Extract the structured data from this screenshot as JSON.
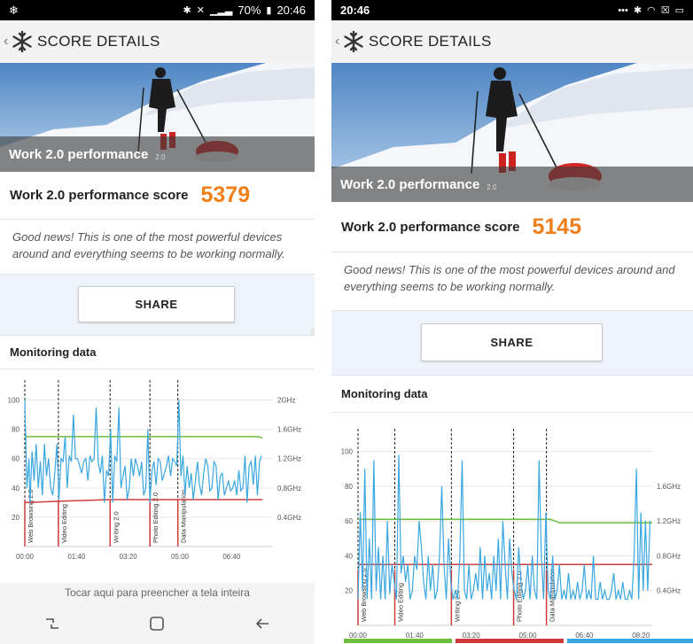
{
  "app": {
    "title": "SCORE DETAILS",
    "benchmark_name": "Work 2.0 performance",
    "benchmark_version": "2.0"
  },
  "colors": {
    "score": "#f07f1a",
    "series": "#3aa7e0",
    "frequency_line": "#6cbf3c",
    "temperature_line": "#cf3b3b"
  },
  "left": {
    "status": {
      "time": "20:46",
      "battery": "70%"
    },
    "score_label": "Work 2.0 performance score",
    "score_value": "5379",
    "message": "Good news! This is one of the most powerful devices around and everything seems to be working normally.",
    "share_label": "SHARE",
    "monitor_title": "Monitoring data",
    "caption": "Tocar aqui para preencher a tela inteira",
    "icons": [
      "back-chevron-icon",
      "snowflake-logo-icon",
      "recent-apps-icon",
      "home-icon",
      "back-arrow-icon"
    ]
  },
  "right": {
    "status": {
      "time": "20:46"
    },
    "score_label": "Work 2.0 performance score",
    "score_value": "5145",
    "message": "Good news! This is one of the most powerful devices around and everything seems to be working normally.",
    "share_label": "SHARE",
    "monitor_title": "Monitoring data",
    "icons": [
      "back-chevron-icon",
      "snowflake-logo-icon",
      "wifi-icon",
      "battery-icon"
    ]
  },
  "chart_data": [
    {
      "type": "line",
      "title": "Monitoring data",
      "x_ticks": [
        "00:00",
        "01:40",
        "03:20",
        "05:00",
        "06:40"
      ],
      "x_range_seconds": [
        0,
        480
      ],
      "y_left_ticks": [
        20,
        40,
        60,
        80,
        100
      ],
      "y_left_range": [
        0,
        110
      ],
      "y_right_ticks": [
        "0.4GHz",
        "0.8GHz",
        "1.2GHz",
        "1.6GHz",
        "2GHz"
      ],
      "sections": [
        {
          "name": "Web Browsing 2.0",
          "start": 0
        },
        {
          "name": "Video Editing",
          "start": 65
        },
        {
          "name": "Writing 2.0",
          "start": 165
        },
        {
          "name": "Photo Editing 2.0",
          "start": 242
        },
        {
          "name": "Data Manipulation",
          "start": 296
        }
      ],
      "frequency_level": [
        [
          0,
          75
        ],
        [
          450,
          75
        ],
        [
          460,
          74
        ]
      ],
      "temperature_level": [
        [
          0,
          30
        ],
        [
          70,
          31
        ],
        [
          165,
          32
        ],
        [
          296,
          32
        ],
        [
          460,
          32
        ]
      ],
      "series": [
        {
          "values_seconds": [
            0,
            4,
            8,
            10,
            14,
            18,
            22,
            26,
            30,
            34,
            38,
            42,
            46,
            50,
            54,
            58,
            62,
            66,
            70,
            74,
            78,
            82,
            86,
            90,
            94,
            98,
            102,
            106,
            110,
            114,
            118,
            122,
            126,
            130,
            134,
            138,
            142,
            146,
            150,
            154,
            158,
            162,
            166,
            170,
            174,
            178,
            182,
            186,
            190,
            194,
            198,
            202,
            206,
            210,
            214,
            218,
            222,
            226,
            230,
            234,
            238,
            242,
            246,
            250,
            254,
            258,
            262,
            266,
            270,
            274,
            278,
            282,
            286,
            290,
            294,
            298,
            302,
            306,
            310,
            314,
            318,
            322,
            326,
            330,
            334,
            338,
            342,
            346,
            350,
            354,
            358,
            362,
            366,
            370,
            374,
            378,
            382,
            386,
            390,
            394,
            398,
            402,
            406,
            410,
            414,
            418,
            422,
            426,
            430,
            434,
            438,
            442,
            446,
            450,
            454,
            458
          ],
          "values": [
            100,
            40,
            60,
            30,
            65,
            45,
            70,
            40,
            58,
            35,
            70,
            48,
            60,
            40,
            35,
            50,
            70,
            32,
            60,
            58,
            75,
            40,
            62,
            58,
            90,
            60,
            60,
            55,
            50,
            58,
            60,
            45,
            62,
            58,
            60,
            95,
            58,
            50,
            62,
            30,
            52,
            48,
            80,
            30,
            62,
            58,
            95,
            40,
            48,
            55,
            32,
            40,
            60,
            48,
            60,
            55,
            48,
            58,
            35,
            40,
            80,
            30,
            52,
            58,
            42,
            60,
            58,
            45,
            50,
            55,
            62,
            48,
            60,
            58,
            55,
            100,
            48,
            62,
            35,
            55,
            40,
            50,
            32,
            45,
            58,
            42,
            35,
            50,
            60,
            55,
            38,
            40,
            58,
            55,
            32,
            48,
            50,
            35,
            40,
            45,
            38,
            40,
            45,
            35,
            52,
            38,
            40,
            62,
            30,
            55,
            58,
            42,
            62,
            35,
            58,
            62
          ]
        }
      ]
    },
    {
      "type": "line",
      "title": "Monitoring data",
      "x_ticks": [
        "00:00",
        "01:40",
        "03:20",
        "05:00",
        "06:40",
        "08:20"
      ],
      "x_range_seconds": [
        0,
        520
      ],
      "y_left_ticks": [
        20,
        40,
        60,
        80,
        100
      ],
      "y_left_range": [
        0,
        110
      ],
      "y_right_ticks": [
        "0.4GHz",
        "0.8GHz",
        "1.2GHz",
        "1.6GHz"
      ],
      "sections": [
        {
          "name": "Web Browsing 2.0",
          "start": 0
        },
        {
          "name": "Video Editing",
          "start": 65
        },
        {
          "name": "Writing 2.0",
          "start": 165
        },
        {
          "name": "Photo Editing 2.0",
          "start": 275
        },
        {
          "name": "Data Manipulation",
          "start": 333
        }
      ],
      "frequency_level": [
        [
          0,
          61
        ],
        [
          340,
          61
        ],
        [
          356,
          59
        ],
        [
          520,
          59
        ]
      ],
      "temperature_level": [
        [
          0,
          35
        ],
        [
          520,
          35
        ]
      ],
      "series": [
        {
          "values_seconds": [
            0,
            4,
            8,
            12,
            16,
            20,
            24,
            28,
            32,
            36,
            40,
            44,
            48,
            52,
            56,
            60,
            64,
            68,
            72,
            76,
            80,
            84,
            88,
            92,
            96,
            100,
            104,
            108,
            112,
            116,
            120,
            124,
            128,
            132,
            136,
            140,
            144,
            148,
            152,
            156,
            160,
            164,
            168,
            172,
            176,
            180,
            184,
            188,
            192,
            196,
            200,
            204,
            208,
            212,
            216,
            220,
            224,
            228,
            232,
            236,
            240,
            244,
            248,
            252,
            256,
            260,
            264,
            268,
            272,
            276,
            280,
            284,
            288,
            292,
            296,
            300,
            304,
            308,
            312,
            316,
            320,
            324,
            328,
            332,
            336,
            340,
            344,
            348,
            352,
            356,
            360,
            364,
            368,
            372,
            376,
            380,
            384,
            388,
            392,
            396,
            400,
            404,
            408,
            412,
            416,
            420,
            424,
            428,
            432,
            436,
            440,
            444,
            448,
            452,
            456,
            460,
            464,
            468,
            472,
            476,
            480,
            484,
            488,
            492,
            496,
            500,
            504,
            508,
            512,
            516
          ],
          "values": [
            15,
            65,
            20,
            90,
            15,
            50,
            15,
            95,
            20,
            45,
            15,
            40,
            15,
            60,
            18,
            35,
            25,
            15,
            98,
            30,
            40,
            25,
            35,
            15,
            20,
            40,
            32,
            60,
            45,
            25,
            15,
            40,
            20,
            35,
            15,
            20,
            40,
            80,
            35,
            15,
            50,
            25,
            15,
            20,
            15,
            40,
            95,
            20,
            15,
            35,
            15,
            20,
            30,
            20,
            45,
            15,
            40,
            20,
            30,
            15,
            40,
            20,
            50,
            15,
            60,
            35,
            15,
            50,
            30,
            20,
            15,
            45,
            25,
            15,
            20,
            35,
            15,
            40,
            20,
            15,
            95,
            40,
            15,
            65,
            20,
            15,
            40,
            15,
            20,
            35,
            15,
            20,
            15,
            30,
            15,
            20,
            15,
            25,
            15,
            20,
            35,
            15,
            20,
            15,
            40,
            15,
            15,
            25,
            15,
            20,
            15,
            15,
            20,
            30,
            15,
            20,
            15,
            25,
            15,
            15,
            20,
            15,
            40,
            90,
            15,
            65,
            20,
            60,
            20,
            60
          ]
        }
      ]
    }
  ]
}
